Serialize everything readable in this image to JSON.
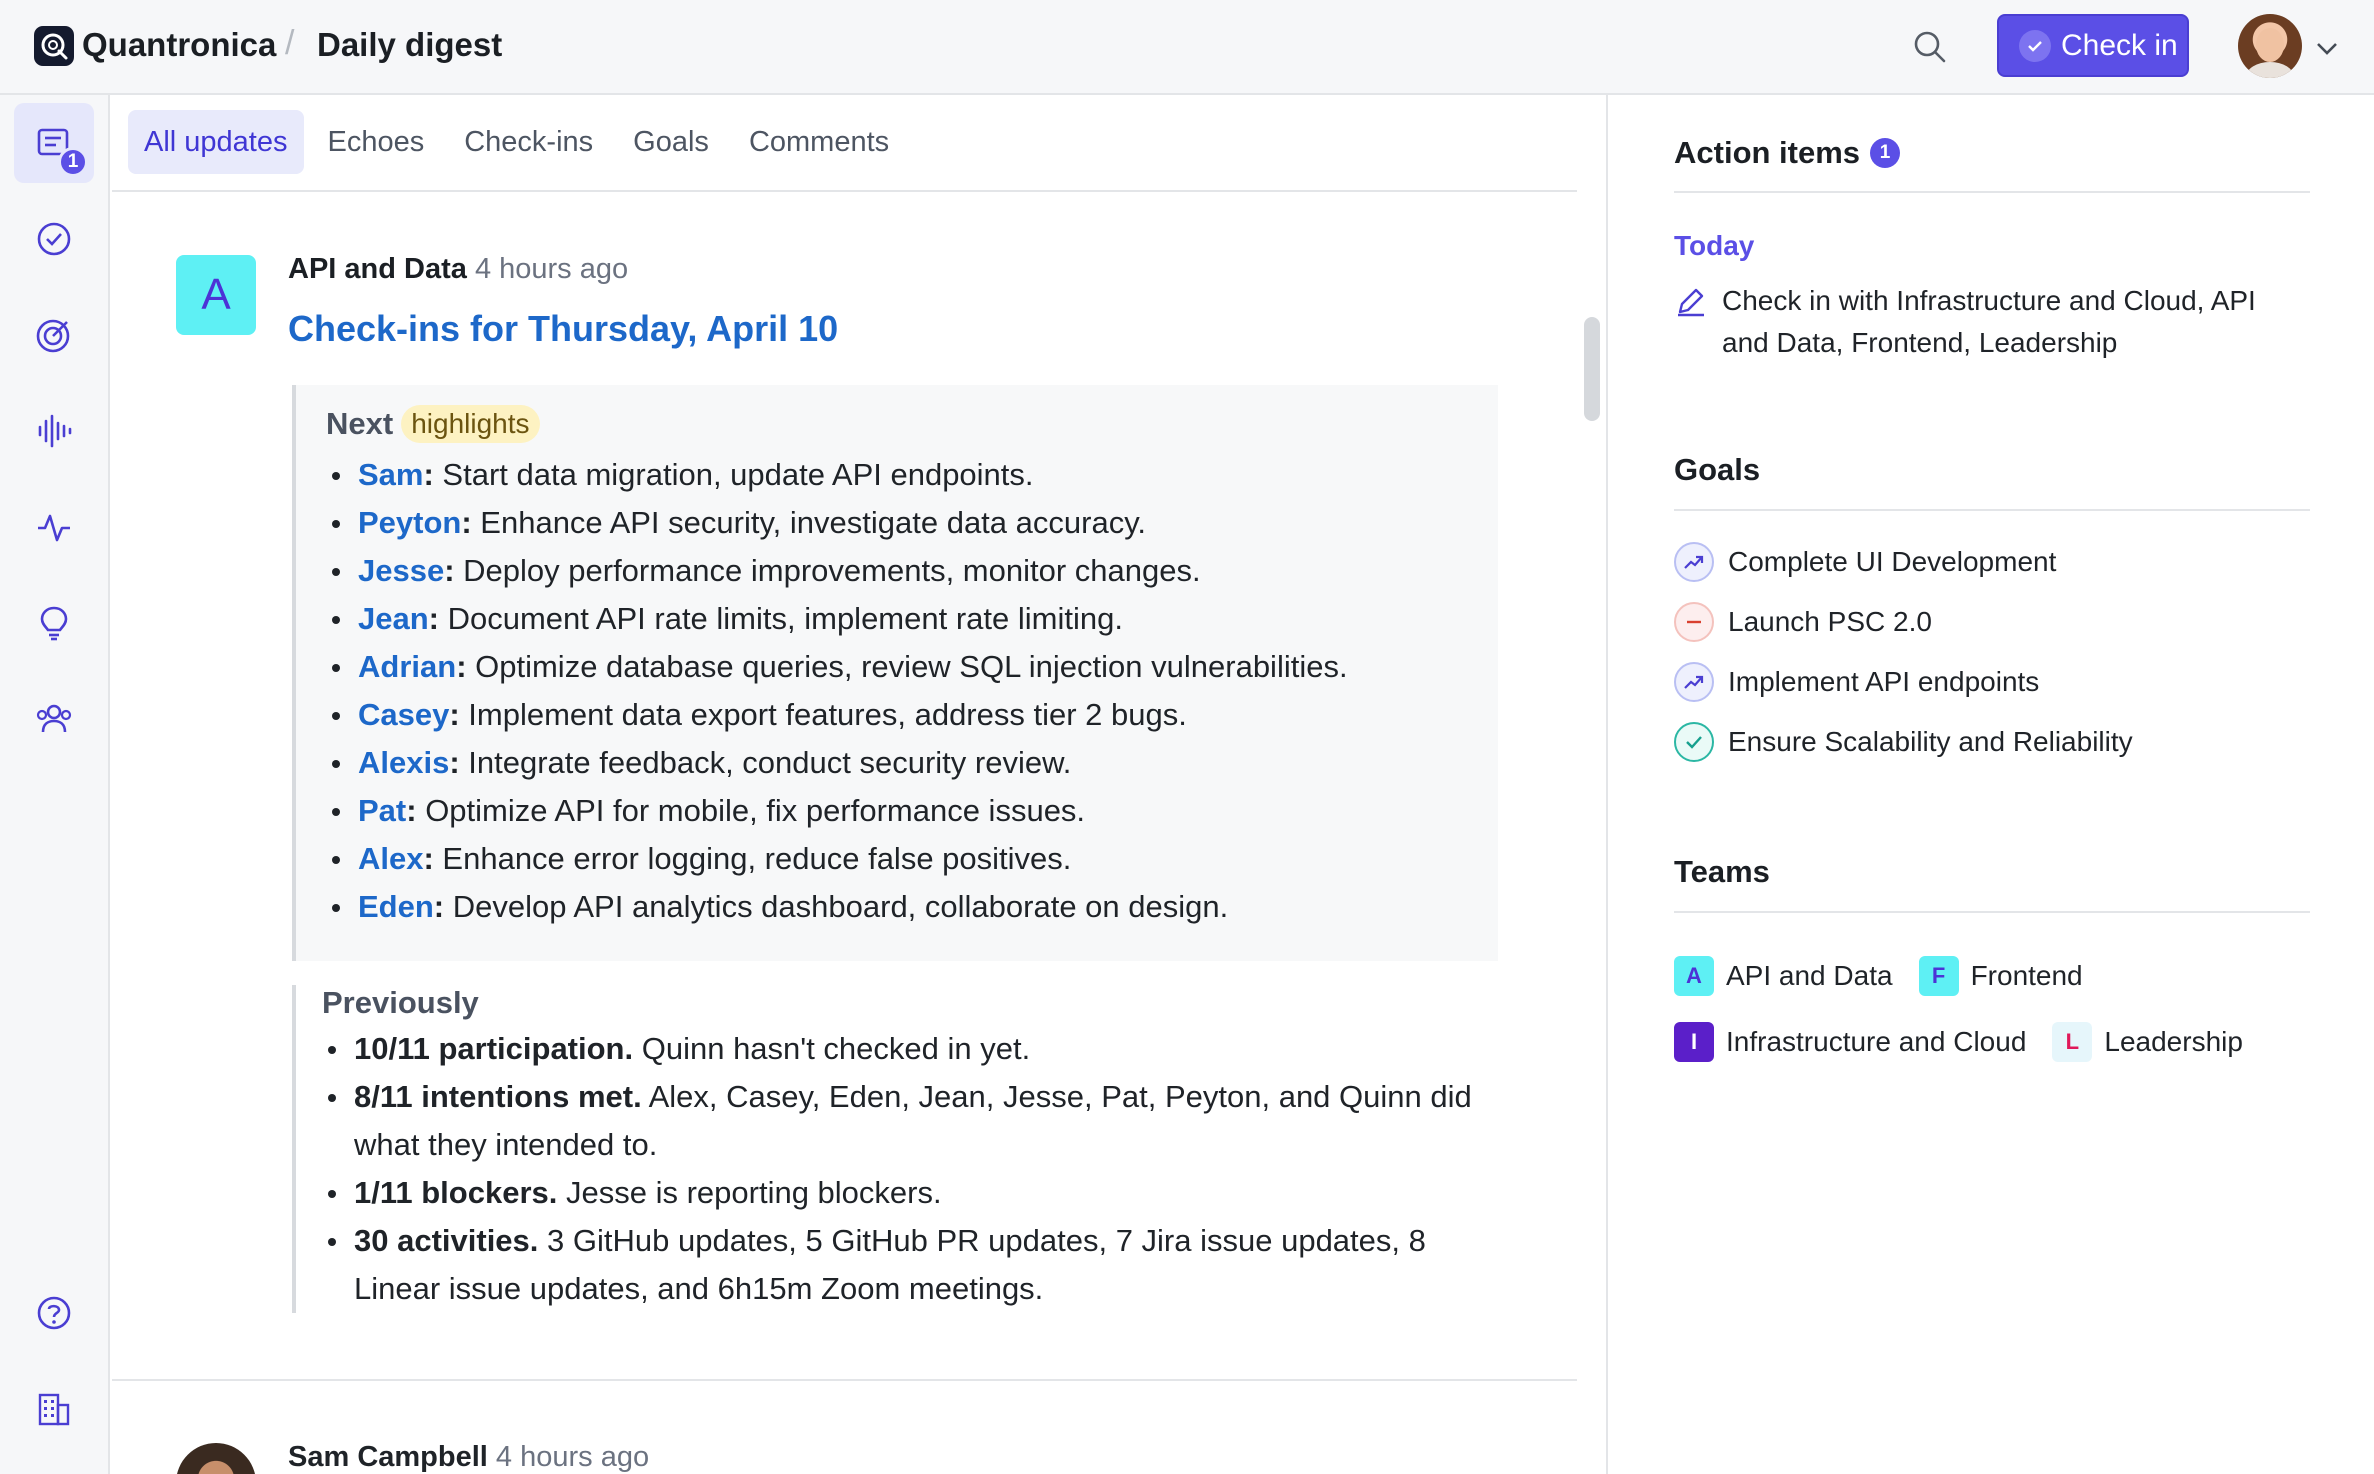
{
  "header": {
    "brand": "Quantronica",
    "separator": "/",
    "crumb": "Daily digest",
    "checkin_label": "Check in"
  },
  "rail": {
    "digest_badge": "1"
  },
  "tabs": [
    {
      "label": "All updates",
      "active": true
    },
    {
      "label": "Echoes"
    },
    {
      "label": "Check-ins"
    },
    {
      "label": "Goals"
    },
    {
      "label": "Comments"
    }
  ],
  "post": {
    "avatar_letter": "A",
    "team": "API and Data",
    "time": "4 hours ago",
    "title": "Check-ins for Thursday, April 10",
    "next_label": "Next",
    "highlights_label": "highlights",
    "next_items": [
      {
        "name": "Sam",
        "text": "Start data migration, update API endpoints."
      },
      {
        "name": "Peyton",
        "text": "Enhance API security, investigate data accuracy."
      },
      {
        "name": "Jesse",
        "text": "Deploy performance improvements, monitor changes."
      },
      {
        "name": "Jean",
        "text": "Document API rate limits, implement rate limiting."
      },
      {
        "name": "Adrian",
        "text": "Optimize database queries, review SQL injection vulnerabilities."
      },
      {
        "name": "Casey",
        "text": "Implement data export features, address tier 2 bugs."
      },
      {
        "name": "Alexis",
        "text": "Integrate feedback, conduct security review."
      },
      {
        "name": "Pat",
        "text": "Optimize API for mobile, fix performance issues."
      },
      {
        "name": "Alex",
        "text": "Enhance error logging, reduce false positives."
      },
      {
        "name": "Eden",
        "text": "Develop API analytics dashboard, collaborate on design."
      }
    ],
    "previously_label": "Previously",
    "previously_items": [
      {
        "bold": "10/11 participation.",
        "text": "Quinn hasn't checked in yet."
      },
      {
        "bold": "8/11 intentions met.",
        "text": "Alex, Casey, Eden, Jean, Jesse, Pat, Peyton, and Quinn did what they intended to."
      },
      {
        "bold": "1/11 blockers.",
        "text": "Jesse is reporting blockers."
      },
      {
        "bold": "30 activities.",
        "text": "3 GitHub updates, 5 GitHub PR updates, 7 Jira issue updates, 8 Linear issue updates, and 6h15m Zoom meetings."
      }
    ]
  },
  "post2": {
    "author": "Sam Campbell",
    "time": "4 hours ago"
  },
  "right": {
    "action_title": "Action items",
    "action_badge": "1",
    "today_label": "Today",
    "action_text": "Check in with Infrastructure and Cloud, API and Data, Frontend, Leadership",
    "goals_title": "Goals",
    "goals": [
      {
        "label": "Complete UI Development",
        "status": "on-track"
      },
      {
        "label": "Launch PSC 2.0",
        "status": "off-track"
      },
      {
        "label": "Implement API endpoints",
        "status": "on-track"
      },
      {
        "label": "Ensure Scalability and Reliability",
        "status": "done"
      }
    ],
    "teams_title": "Teams",
    "teams": [
      {
        "letter": "A",
        "name": "API and Data",
        "bg": "#5ef0f4",
        "fg": "#4c33d6"
      },
      {
        "letter": "F",
        "name": "Frontend",
        "bg": "#5ef0f4",
        "fg": "#4c33d6"
      },
      {
        "letter": "I",
        "name": "Infrastructure and Cloud",
        "bg": "#5b1fc9",
        "fg": "#ffffff"
      },
      {
        "letter": "L",
        "name": "Leadership",
        "bg": "#e6f6fb",
        "fg": "#e0195a"
      }
    ]
  }
}
